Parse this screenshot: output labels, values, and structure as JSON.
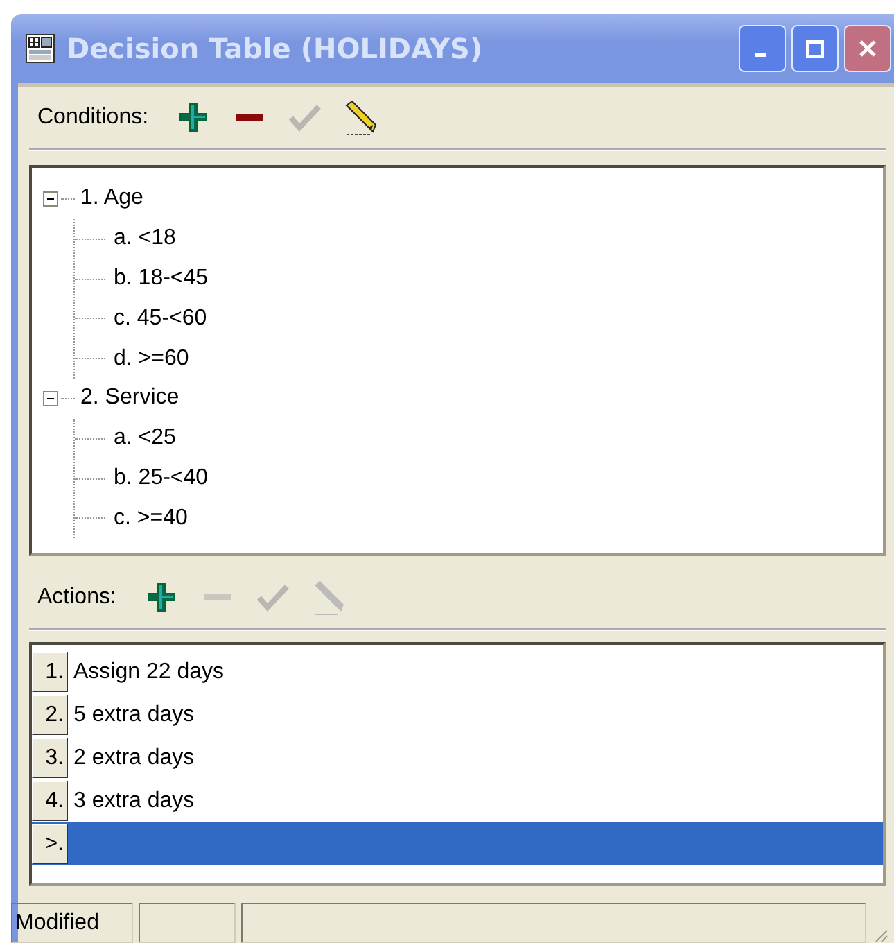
{
  "window": {
    "title": "Decision Table (HOLIDAYS)",
    "active": false
  },
  "conditions": {
    "label": "Conditions:",
    "tools": [
      {
        "kind": "add",
        "disabled": false
      },
      {
        "kind": "remove",
        "disabled": false
      },
      {
        "kind": "accept",
        "disabled": true
      },
      {
        "kind": "edit",
        "disabled": false
      }
    ],
    "tree": [
      {
        "label": "1. Age",
        "expanded": true,
        "children": [
          {
            "label": "a. <18"
          },
          {
            "label": "b. 18-<45"
          },
          {
            "label": "c. 45-<60"
          },
          {
            "label": "d. >=60"
          }
        ]
      },
      {
        "label": "2. Service",
        "expanded": true,
        "children": [
          {
            "label": "a. <25"
          },
          {
            "label": "b. 25-<40"
          },
          {
            "label": "c. >=40"
          }
        ]
      }
    ]
  },
  "actions": {
    "label": "Actions:",
    "tools": [
      {
        "kind": "add",
        "disabled": false
      },
      {
        "kind": "remove",
        "disabled": true
      },
      {
        "kind": "accept",
        "disabled": true
      },
      {
        "kind": "edit",
        "disabled": true
      }
    ],
    "rows": [
      {
        "number": "1.",
        "text": "Assign 22 days",
        "selected": false
      },
      {
        "number": "2.",
        "text": "5 extra days",
        "selected": false
      },
      {
        "number": "3.",
        "text": "2 extra days",
        "selected": false
      },
      {
        "number": "4.",
        "text": "3 extra days",
        "selected": false
      },
      {
        "number": ">.",
        "selected": true
      }
    ]
  },
  "status_bar": {
    "panes": [
      {
        "text": "Modified"
      }
    ]
  }
}
